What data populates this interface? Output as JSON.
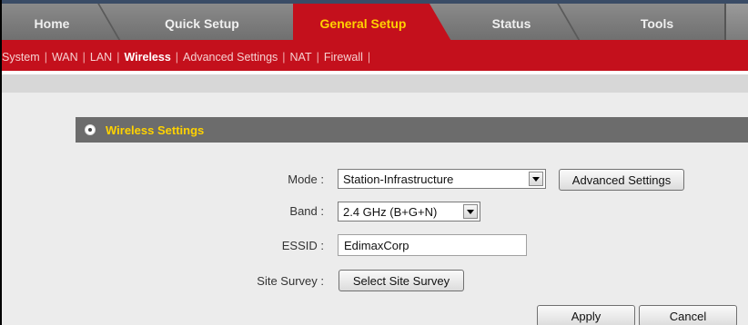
{
  "tabs": [
    {
      "label": "Home"
    },
    {
      "label": "Quick Setup"
    },
    {
      "label": "General Setup",
      "active": true
    },
    {
      "label": "Status"
    },
    {
      "label": "Tools"
    }
  ],
  "subnav": {
    "items": [
      "System",
      "WAN",
      "LAN",
      "Wireless",
      "Advanced Settings",
      "NAT",
      "Firewall"
    ],
    "active": "Wireless",
    "separator": "|"
  },
  "section": {
    "title": "Wireless Settings",
    "icon": "radio-bullet-icon"
  },
  "form": {
    "mode": {
      "label": "Mode :",
      "value": "Station-Infrastructure"
    },
    "advanced_button": "Advanced Settings",
    "band": {
      "label": "Band :",
      "value": "2.4 GHz (B+G+N)"
    },
    "essid": {
      "label": "ESSID :",
      "value": "EdimaxCorp"
    },
    "site_survey": {
      "label": "Site Survey :",
      "button": "Select Site Survey"
    }
  },
  "actions": {
    "apply": "Apply",
    "cancel": "Cancel"
  },
  "colors": {
    "accent_red": "#c4101c",
    "active_tab_text": "#ffd200",
    "section_title": "#ffd200",
    "tabbar_gray": "#7a7a7a",
    "section_bar": "#6c6c6c"
  }
}
